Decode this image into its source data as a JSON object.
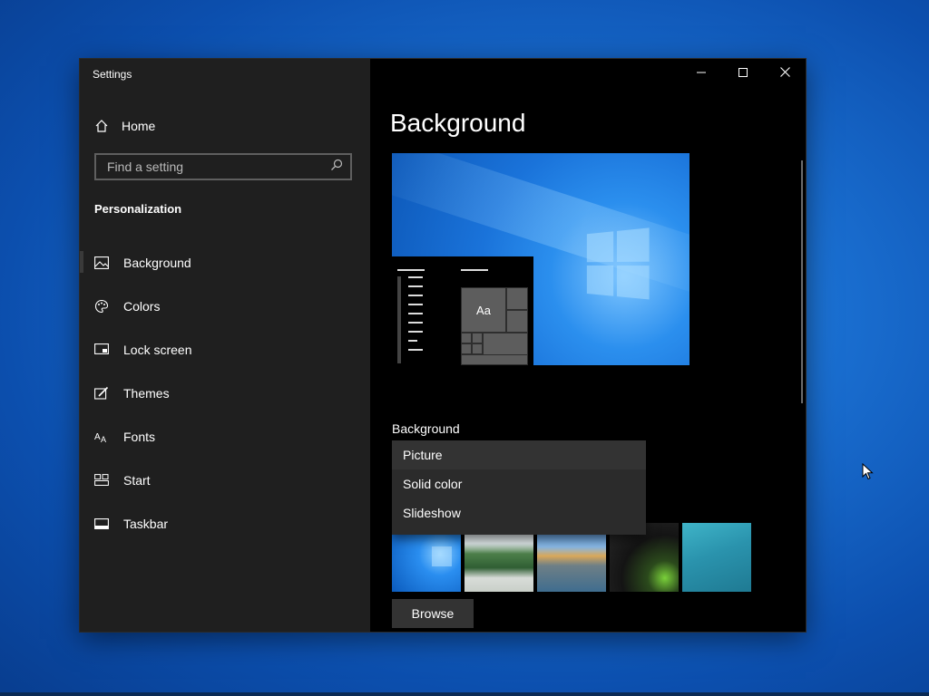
{
  "window": {
    "title": "Settings",
    "controls": [
      "minimize-icon",
      "maximize-icon",
      "close-icon"
    ]
  },
  "sidebar": {
    "home_label": "Home",
    "search": {
      "placeholder": "Find a setting",
      "value": ""
    },
    "section_title": "Personalization",
    "items": [
      {
        "label": "Background",
        "icon": "picture-icon",
        "active": true
      },
      {
        "label": "Colors",
        "icon": "palette-icon",
        "active": false
      },
      {
        "label": "Lock screen",
        "icon": "lock-screen-icon",
        "active": false
      },
      {
        "label": "Themes",
        "icon": "themes-brush-icon",
        "active": false
      },
      {
        "label": "Fonts",
        "icon": "fonts-icon",
        "active": false
      },
      {
        "label": "Start",
        "icon": "start-grid-icon",
        "active": false
      },
      {
        "label": "Taskbar",
        "icon": "taskbar-icon",
        "active": false
      }
    ]
  },
  "main": {
    "title": "Background",
    "preview": {
      "tile_text": "Aa"
    },
    "background_label": "Background",
    "background_dropdown": {
      "options": [
        "Picture",
        "Solid color",
        "Slideshow"
      ],
      "selected": "Picture",
      "expanded": true
    },
    "browse_label": "Browse"
  },
  "colors": {
    "sidebar_bg": "#1f1f1f",
    "content_bg": "#000000",
    "accent_blue": "#1a73da"
  }
}
